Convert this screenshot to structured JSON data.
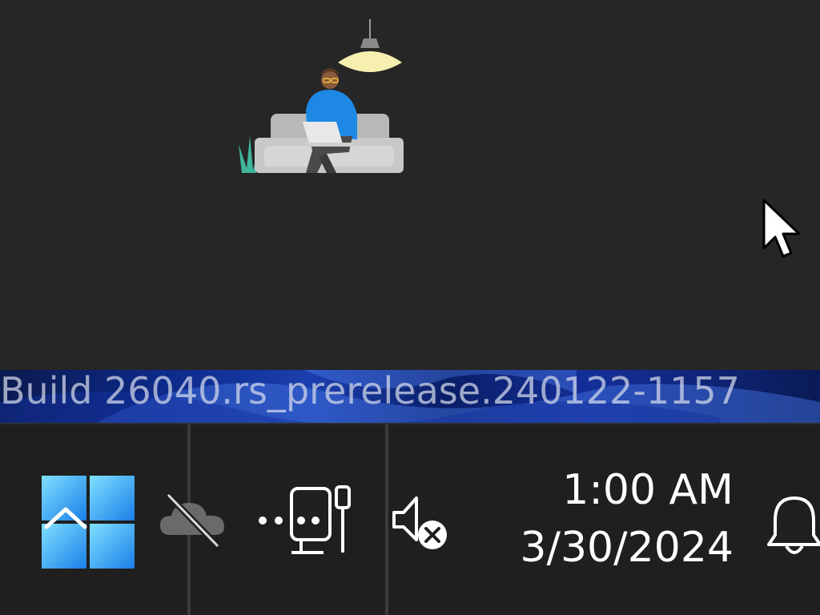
{
  "desktop": {
    "build_watermark": "Build 26040.rs_prerelease.240122-1157"
  },
  "taskbar": {
    "start_icon": "windows-logo-icon",
    "tray": {
      "show_hidden_icon": "chevron-up-icon",
      "onedrive_icon": "onedrive-offline-icon",
      "network_icon": "ethernet-disconnected-icon",
      "volume_icon": "speaker-muted-icon"
    },
    "clock": {
      "time": "1:00 AM",
      "date": "3/30/2024"
    },
    "notifications_icon": "bell-icon"
  },
  "colors": {
    "background": "#262626",
    "taskbar": "#1f1f1f",
    "start_blue_light": "#7fe0ff",
    "start_blue_dark": "#1a7fe8",
    "person_shirt": "#1e88e5"
  }
}
